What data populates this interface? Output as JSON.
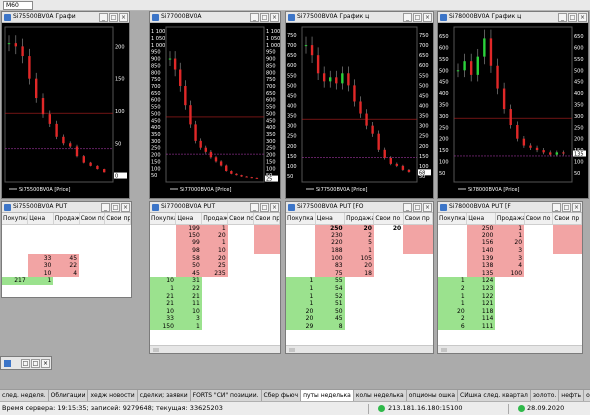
{
  "toolbar": {
    "combo": "M60"
  },
  "columns": [
    "Покупка",
    "Цена",
    "Продажа",
    "Свои по",
    "Свои пр"
  ],
  "charts": [
    {
      "title": "Si75500BV0A Графи",
      "legend": "Si75500BV0A [Price]",
      "right_ticks": [
        "200",
        "150",
        "100",
        "50",
        "0"
      ],
      "left_ticks": [],
      "right_mark": "0"
    },
    {
      "title": "Si77000BV0A",
      "legend": "Si77000BV0A [Price]",
      "right_ticks": [
        "1 100",
        "1 050",
        "1 000",
        "950",
        "900",
        "850",
        "800",
        "750",
        "700",
        "650",
        "600",
        "550",
        "500",
        "450",
        "400",
        "350",
        "300",
        "250",
        "200",
        "150",
        "100",
        "50"
      ],
      "left_ticks": [
        "1 100",
        "1 050",
        "1 000",
        "950",
        "900",
        "850",
        "800",
        "750",
        "700",
        "650",
        "600",
        "550",
        "500",
        "450",
        "400",
        "350",
        "300",
        "250",
        "200",
        "150",
        "100",
        "50"
      ],
      "right_mark": "25"
    },
    {
      "title": "Si77500BV0A График ц",
      "legend": "Si77500BV0A [Price]",
      "right_ticks": [
        "750",
        "700",
        "650",
        "600",
        "550",
        "500",
        "450",
        "400",
        "350",
        "300",
        "250",
        "200",
        "150",
        "100",
        "50"
      ],
      "left_ticks": [
        "750",
        "700",
        "650",
        "600",
        "550",
        "500",
        "450",
        "400",
        "350",
        "300",
        "250",
        "200",
        "150",
        "100",
        "50"
      ],
      "right_mark": "68"
    },
    {
      "title": "Si78000BV0A График ц",
      "legend": "Si78000BV0A [Price]",
      "right_ticks": [
        "650",
        "600",
        "550",
        "500",
        "450",
        "400",
        "350",
        "300",
        "250",
        "200",
        "150",
        "100",
        "50"
      ],
      "left_ticks": [
        "650",
        "600",
        "550",
        "500",
        "450",
        "400",
        "350",
        "300",
        "250",
        "200",
        "150",
        "100",
        "50"
      ],
      "right_mark": "135"
    }
  ],
  "books": [
    {
      "title": "Si75500BV0A PUT",
      "rows": [
        {
          "bid": "",
          "price": "",
          "ask": "",
          "type": "blank"
        },
        {
          "bid": "",
          "price": "",
          "ask": "",
          "type": "blank"
        },
        {
          "bid": "",
          "price": "",
          "ask": "",
          "type": "blank"
        },
        {
          "bid": "",
          "price": "",
          "ask": "",
          "type": "blank"
        },
        {
          "bid": "",
          "price": "33",
          "ask": "45",
          "type": "ask"
        },
        {
          "bid": "",
          "price": "30",
          "ask": "22",
          "type": "ask"
        },
        {
          "bid": "",
          "price": "10",
          "ask": "4",
          "type": "ask"
        },
        {
          "bid": "217",
          "price": "1",
          "ask": "",
          "type": "bid"
        }
      ]
    },
    {
      "title": "Si77000BV0A PUT",
      "rows": [
        {
          "bid": "",
          "price": "199",
          "ask": "1",
          "type": "ask"
        },
        {
          "bid": "",
          "price": "150",
          "ask": "20",
          "type": "ask"
        },
        {
          "bid": "",
          "price": "99",
          "ask": "1",
          "type": "ask"
        },
        {
          "bid": "",
          "price": "98",
          "ask": "10",
          "type": "ask"
        },
        {
          "bid": "",
          "price": "58",
          "ask": "20",
          "type": "ask"
        },
        {
          "bid": "",
          "price": "50",
          "ask": "25",
          "type": "ask"
        },
        {
          "bid": "",
          "price": "45",
          "ask": "235",
          "type": "ask"
        },
        {
          "bid": "10",
          "price": "31",
          "ask": "",
          "type": "bid"
        },
        {
          "bid": "1",
          "price": "22",
          "ask": "",
          "type": "bid"
        },
        {
          "bid": "21",
          "price": "21",
          "ask": "",
          "type": "bid"
        },
        {
          "bid": "21",
          "price": "11",
          "ask": "",
          "type": "bid"
        },
        {
          "bid": "10",
          "price": "10",
          "ask": "",
          "type": "bid"
        },
        {
          "bid": "33",
          "price": "3",
          "ask": "",
          "type": "bid"
        },
        {
          "bid": "150",
          "price": "1",
          "ask": "",
          "type": "bid"
        }
      ]
    },
    {
      "title": "Si77500BV0A PUT [FO",
      "rows": [
        {
          "bid": "",
          "price": "250",
          "ask": "20",
          "own": "20",
          "type": "ask"
        },
        {
          "bid": "",
          "price": "230",
          "ask": "2",
          "type": "ask"
        },
        {
          "bid": "",
          "price": "220",
          "ask": "5",
          "type": "ask"
        },
        {
          "bid": "",
          "price": "188",
          "ask": "1",
          "type": "ask"
        },
        {
          "bid": "",
          "price": "100",
          "ask": "105",
          "type": "ask"
        },
        {
          "bid": "",
          "price": "83",
          "ask": "20",
          "type": "ask"
        },
        {
          "bid": "",
          "price": "75",
          "ask": "18",
          "type": "ask"
        },
        {
          "bid": "1",
          "price": "55",
          "ask": "",
          "type": "bid"
        },
        {
          "bid": "1",
          "price": "54",
          "ask": "",
          "type": "bid"
        },
        {
          "bid": "1",
          "price": "52",
          "ask": "",
          "type": "bid"
        },
        {
          "bid": "1",
          "price": "51",
          "ask": "",
          "type": "bid"
        },
        {
          "bid": "20",
          "price": "50",
          "ask": "",
          "type": "bid"
        },
        {
          "bid": "20",
          "price": "45",
          "ask": "",
          "type": "bid"
        },
        {
          "bid": "29",
          "price": "8",
          "ask": "",
          "type": "bid"
        }
      ]
    },
    {
      "title": "Si78000BV0A PUT [F",
      "rows": [
        {
          "bid": "",
          "price": "250",
          "ask": "1",
          "type": "ask"
        },
        {
          "bid": "",
          "price": "200",
          "ask": "1",
          "type": "ask"
        },
        {
          "bid": "",
          "price": "156",
          "ask": "20",
          "type": "ask"
        },
        {
          "bid": "",
          "price": "140",
          "ask": "3",
          "type": "ask"
        },
        {
          "bid": "",
          "price": "139",
          "ask": "3",
          "type": "ask"
        },
        {
          "bid": "",
          "price": "138",
          "ask": "4",
          "type": "ask"
        },
        {
          "bid": "",
          "price": "135",
          "ask": "100",
          "type": "ask"
        },
        {
          "bid": "1",
          "price": "124",
          "ask": "",
          "type": "bid"
        },
        {
          "bid": "2",
          "price": "123",
          "ask": "",
          "type": "bid"
        },
        {
          "bid": "1",
          "price": "122",
          "ask": "",
          "type": "bid"
        },
        {
          "bid": "1",
          "price": "121",
          "ask": "",
          "type": "bid"
        },
        {
          "bid": "20",
          "price": "118",
          "ask": "",
          "type": "bid"
        },
        {
          "bid": "2",
          "price": "114",
          "ask": "",
          "type": "bid"
        },
        {
          "bid": "6",
          "price": "111",
          "ask": "",
          "type": "bid"
        }
      ]
    }
  ],
  "tabs": [
    {
      "label": "след. неделя.",
      "active": false
    },
    {
      "label": "Облигации",
      "active": false
    },
    {
      "label": "хедж новости",
      "active": false
    },
    {
      "label": "сделки; заявки",
      "active": false
    },
    {
      "label": "FORTS \"СИ\" позиции.",
      "active": false
    },
    {
      "label": "Сбер фьюч",
      "active": false
    },
    {
      "label": "путы неделька",
      "active": true
    },
    {
      "label": "колы неделька",
      "active": false
    },
    {
      "label": "опционы ошка",
      "active": false
    },
    {
      "label": "СИшка след. квартал",
      "active": false
    },
    {
      "label": "золото.",
      "active": false
    },
    {
      "label": "нефть",
      "active": false
    },
    {
      "label": "опционы ртс",
      "active": false
    },
    {
      "label": "яндекс",
      "active": false
    }
  ],
  "status": {
    "server": "Время сервера: 19:15:35; записей: 9279648; текущая: 33625203",
    "connection": "213.181.16.180:15100",
    "date": "28.09.2020",
    "connected_color": "#2fb94a"
  }
}
